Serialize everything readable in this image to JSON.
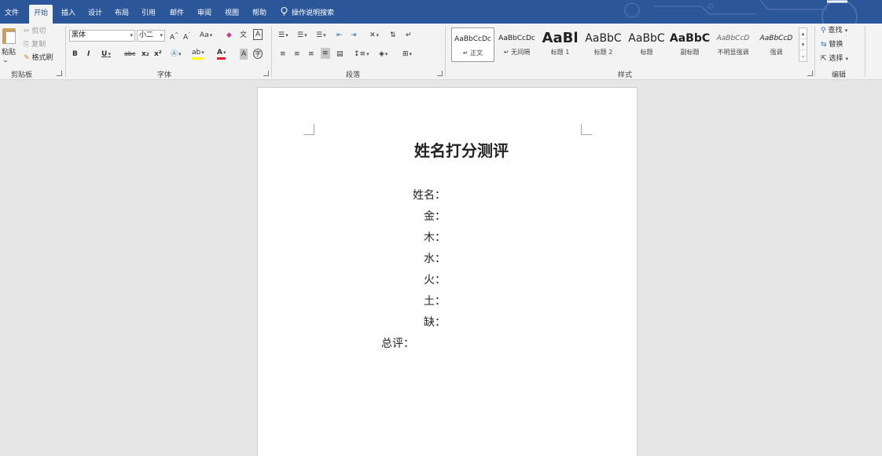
{
  "tabs": [
    {
      "name": "tab-file",
      "label": "文件",
      "active": false
    },
    {
      "name": "tab-home",
      "label": "开始",
      "active": true
    },
    {
      "name": "tab-insert",
      "label": "插入",
      "active": false
    },
    {
      "name": "tab-design",
      "label": "设计",
      "active": false
    },
    {
      "name": "tab-layout",
      "label": "布局",
      "active": false
    },
    {
      "name": "tab-references",
      "label": "引用",
      "active": false
    },
    {
      "name": "tab-mailings",
      "label": "邮件",
      "active": false
    },
    {
      "name": "tab-review",
      "label": "审阅",
      "active": false
    },
    {
      "name": "tab-view",
      "label": "视图",
      "active": false
    },
    {
      "name": "tab-help",
      "label": "帮助",
      "active": false
    }
  ],
  "tell_me": "操作说明搜索",
  "clipboard": {
    "paste": "粘贴",
    "cut": "剪切",
    "copy": "复制",
    "format_painter": "格式刷",
    "group_label": "剪贴板"
  },
  "font": {
    "family": "黑体",
    "size": "小二",
    "group_label": "字体",
    "grow": "A",
    "shrink": "A",
    "change_case": "Aa",
    "bold": "B",
    "italic": "I",
    "underline": "U",
    "strikethrough": "abc",
    "subscript": "x₂",
    "superscript": "x²",
    "font_color": "A",
    "phonetic": "文",
    "char_border": "A",
    "char_shading": "A",
    "enclose": "字"
  },
  "paragraph": {
    "group_label": "段落"
  },
  "styles": {
    "group_label": "样式",
    "items": [
      {
        "sample": "AaBbCcDc",
        "name": "↵ 正文",
        "selected": true
      },
      {
        "sample": "AaBbCcDc",
        "name": "↵ 无间隔",
        "selected": false
      },
      {
        "sample": "AaBl",
        "name": "标题 1",
        "selected": false
      },
      {
        "sample": "AaBbC",
        "name": "标题 2",
        "selected": false
      },
      {
        "sample": "AaBbC",
        "name": "标题",
        "selected": false
      },
      {
        "sample": "AaBbC",
        "name": "副标题",
        "selected": false
      },
      {
        "sample": "AaBbCcD",
        "name": "不明显强调",
        "selected": false
      },
      {
        "sample": "AaBbCcD",
        "name": "强调",
        "selected": false
      }
    ]
  },
  "editing": {
    "find": "查找",
    "replace": "替换",
    "select": "选择",
    "group_label": "编辑"
  },
  "document": {
    "title": "姓名打分测评",
    "fields": [
      "姓名：",
      "金：",
      "木：",
      "水：",
      "火：",
      "土：",
      "缺："
    ],
    "summary": "总评："
  },
  "colors": {
    "accent": "#2b579a",
    "ribbon": "#f3f3f3",
    "canvas": "#e6e6e6"
  }
}
